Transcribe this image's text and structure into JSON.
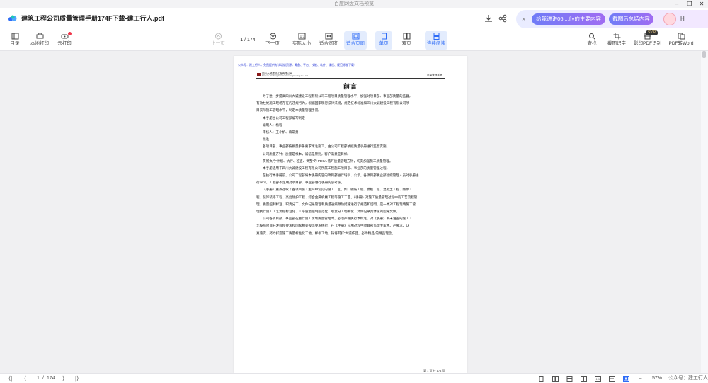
{
  "window": {
    "title": "百度网盘文档预览",
    "minimize": "–",
    "maximize": "❐",
    "close": "✕"
  },
  "header": {
    "doc_title": "建筑工程公司质量管理手册174F下载-建工行人.pdf",
    "ai": {
      "close": "×",
      "pill1": "给我讲讲06....flv的主要内容",
      "pill2": "截图后总结内容",
      "hi": "Hi"
    }
  },
  "toolbar": {
    "left": [
      {
        "label": "目录"
      },
      {
        "label": "本地打印"
      },
      {
        "label": "云打印"
      }
    ],
    "center": {
      "prev": "上一页",
      "page_current": "1",
      "page_sep": "/",
      "page_total": "174",
      "next": "下一页",
      "actual_size": "实际大小",
      "fit_width": "适合宽度",
      "fit_page": "适合页面",
      "single": "单页",
      "double": "双页",
      "continuous": "连续阅读"
    },
    "right": {
      "find": "查找",
      "screenshot": "截图识字",
      "ocr": "影印PDF识别",
      "svip": "SVIP",
      "to_word": "PDF转Word"
    }
  },
  "document": {
    "note": "公众号：建工行人，免费提供考试培训资源，筹备、平台、技能、软件、课程、规范标准下载！",
    "company": "四川大城建设工程有限公司",
    "company_en": "Sichuan Dacheng Construction Engineering Co., Ltd.",
    "header_right": "质量管理手册",
    "heading": "前言",
    "lines": [
      {
        "text": "为了进一步提高四川大诚建设工程有限公司工程项目质量管理水平，加强对项目部、事业部质量的监督，",
        "indent": true
      },
      {
        "text": "有效杜绝施工现场存在的违规行为，根据国家现行法律法规，规范技术标准和四川大诚建设工程有限公司项",
        "indent": false
      },
      {
        "text": "目实际施工管理水平，制定本质量管理手册。",
        "indent": false
      },
      {
        "text": "本手册由公司工程部编写制定",
        "indent": true
      },
      {
        "text": "编制人：杨程",
        "indent": true
      },
      {
        "text": "审核人：王小帆、蒋常勇",
        "indent": true
      },
      {
        "text": "批准：",
        "indent": true
      },
      {
        "text": "各项目部、事业部按质量手册要求精准施工，由公司工程部依据质量手册进行监督实施。",
        "indent": true
      },
      {
        "text": "公司质量方针：质量是根本，诚信是原则，客户满意是目标。",
        "indent": true
      },
      {
        "text": "贯彻执行“计划、执行、检查、调整”的 PDCA 循环质量管理方针，切实加强施工质量管理。",
        "indent": true
      },
      {
        "text": "本手册适用于四川大诚建设工程有限公司所属工程施工项目部、事业部的质量管理过程。",
        "indent": true
      },
      {
        "text": "在执行本手册前，公司工程部将本手册内容向项目部进行培训、公示，各项目部事业部组织管理人员对手册进",
        "indent": true
      },
      {
        "text": "行学习，工程部不定期对项目部、事业部进行手册内容考核。",
        "indent": false
      },
      {
        "text": "《手册》重点选取了各项目施工生产中常见的施工工艺，如：钢筋工程、模板工程、混凝土工程、防水工",
        "indent": true
      },
      {
        "text": "程、装饰装修工程、高处防护工程、综合金属机械工程等施工工艺，《手册》对施工质量管理过程中的工艺流程管",
        "indent": false
      },
      {
        "text": "理、质量控制标准、职责分工、文件记录管理和质量通病预防措施进行了规范和说明，是一本对工程现场施工管",
        "indent": false
      },
      {
        "text": "理执行施工工艺流程标准化、工序质量控制规范化、职责分工明确化、文件记录具体化的指导文件。",
        "indent": false
      },
      {
        "text": "公司各项目部、事业部在进行施工现场质量管理时，必须严格执行本标准，对《手册》中未涵盖的施工工",
        "indent": true
      },
      {
        "text": "艺按照项目开发规程要求和国家相关规范要求执行，在《手册》应用过程中项目部监理专家术、严要求、认",
        "indent": false
      },
      {
        "text": "真落实、努力打造施工质量标准化工地，样板工地，铸将其打“大诚作品，必为精品”的精品理念。",
        "indent": false
      }
    ],
    "footer": "第 1 页 共 174 页"
  },
  "status": {
    "first": "⟨|",
    "prev": "⟨",
    "page_current": "1",
    "page_sep": "/",
    "page_total": "174",
    "next": "⟩",
    "last": "|⟩",
    "zoom": "57%",
    "watermark": "公众号：建工行人"
  },
  "colors": {
    "accent": "#2f6cf6",
    "active_bg": "#e3ecfd",
    "badge": "#f0364a",
    "ai_gradient_start": "#6f7cf7",
    "ai_gradient_end": "#a06cf2",
    "note_text": "#2a3bd6"
  },
  "icons": {
    "logo": "baidu-netdisk-cloud-icon",
    "download": "download-icon",
    "share": "share-icon"
  }
}
